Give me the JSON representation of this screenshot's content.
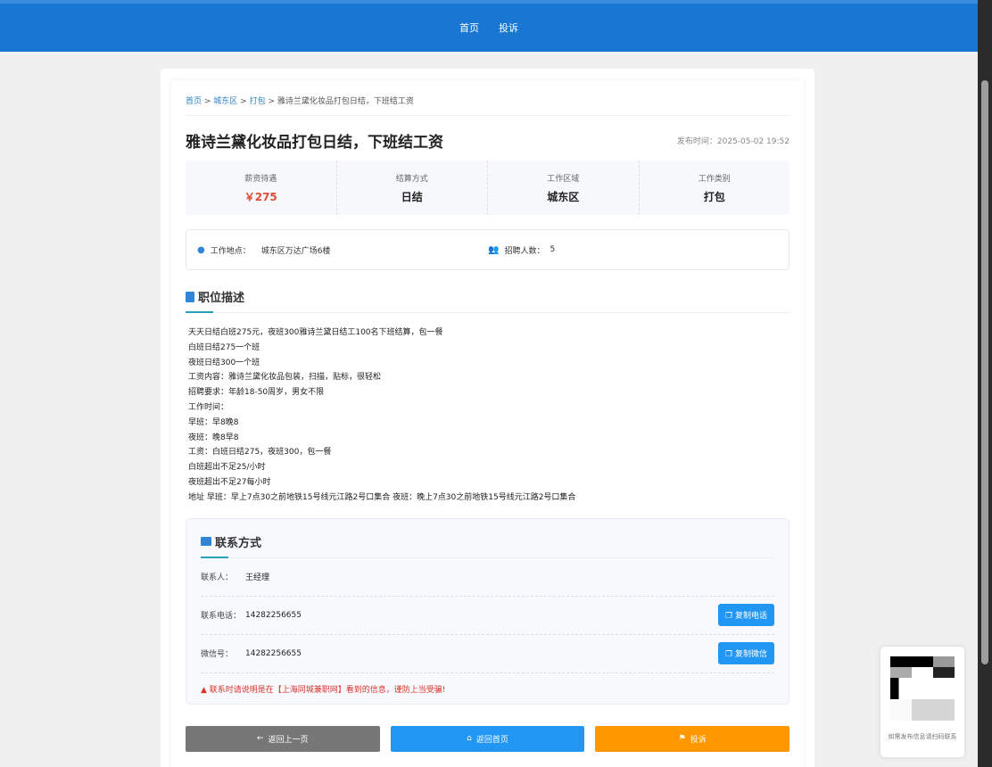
{
  "nav": {
    "items": [
      "首页",
      "投诉"
    ]
  },
  "breadcrumb": {
    "home": "首页",
    "area": "城东区",
    "category": "打包",
    "current": "雅诗兰黛化妆品打包日结，下班结工资"
  },
  "job": {
    "title": "雅诗兰黛化妆品打包日结，下班结工资",
    "publish_time": "发布时间：2025-05-02 19:52",
    "stats": [
      {
        "label": "薪资待遇",
        "value": "￥275"
      },
      {
        "label": "结算方式",
        "value": "日结"
      },
      {
        "label": "工作区域",
        "value": "城东区"
      },
      {
        "label": "工作类别",
        "value": "打包"
      }
    ],
    "location_label": "工作地点：",
    "location": "城东区万达广场6楼",
    "headcount_label": "招聘人数：",
    "headcount": "5"
  },
  "description": {
    "heading": "职位描述",
    "lines": [
      "天天日结白班275元，夜班300雅诗兰黛日结工100名下班结算，包一餐",
      "白班日结275一个班",
      "夜班日结300一个班",
      "工资内容：雅诗兰黛化妆品包装，扫描，贴标，很轻松",
      "招聘要求：年龄18-50周岁，男女不限",
      "工作时间：",
      "早班：早8晚8",
      "夜班：晚8早8",
      "工资：白班日结275，夜班300，包一餐",
      "白班超出不足25/小时",
      "夜班超出不足27每小时",
      "地址 早班：早上7点30之前地铁15号线元江路2号口集合 夜班：晚上7点30之前地铁15号线元江路2号口集合"
    ]
  },
  "contact": {
    "heading": "联系方式",
    "person_label": "联系人：",
    "person": "王经理",
    "phone_label": "联系电话：",
    "phone": "14282256655",
    "copy_phone": "复制电话",
    "wechat_label": "微信号：",
    "wechat": "14282256655",
    "copy_wechat": "复制微信",
    "warning": "联系时请说明是在【上海同城兼职网】看到的信息，谨防上当受骗!"
  },
  "actions": {
    "back": "返回上一页",
    "home": "返回首页",
    "report": "投诉"
  },
  "qr": {
    "caption": "如需发布信息请扫码联系"
  },
  "colors": {
    "primary": "#1976d2",
    "button_blue": "#2196f3",
    "back": "#777777",
    "report": "#ff9800",
    "price": "#e04b3a"
  }
}
